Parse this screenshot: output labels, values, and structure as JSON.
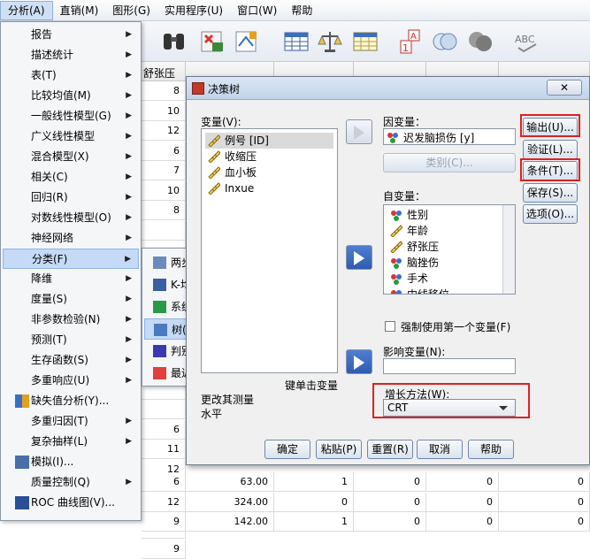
{
  "menubar": [
    {
      "label": "分析(A)"
    },
    {
      "label": "直销(M)"
    },
    {
      "label": "图形(G)"
    },
    {
      "label": "实用程序(U)"
    },
    {
      "label": "窗口(W)"
    },
    {
      "label": "帮助"
    }
  ],
  "analyze_menu": [
    {
      "label": "报告",
      "arrow": true
    },
    {
      "label": "描述统计",
      "arrow": true
    },
    {
      "label": "表(T)",
      "arrow": true
    },
    {
      "label": "比较均值(M)",
      "arrow": true
    },
    {
      "label": "一般线性模型(G)",
      "arrow": true
    },
    {
      "label": "广义线性模型",
      "arrow": true
    },
    {
      "label": "混合模型(X)",
      "arrow": true
    },
    {
      "label": "相关(C)",
      "arrow": true
    },
    {
      "label": "回归(R)",
      "arrow": true
    },
    {
      "label": "对数线性模型(O)",
      "arrow": true
    },
    {
      "label": "神经网络",
      "arrow": true
    },
    {
      "label": "分类(F)",
      "arrow": true
    },
    {
      "label": "降维",
      "arrow": true
    },
    {
      "label": "度量(S)",
      "arrow": true
    },
    {
      "label": "非参数检验(N)",
      "arrow": true
    },
    {
      "label": "预测(T)",
      "arrow": true
    },
    {
      "label": "生存函数(S)",
      "arrow": true
    },
    {
      "label": "多重响应(U)",
      "arrow": true
    },
    {
      "label": "缺失值分析(Y)...",
      "arrow": false
    },
    {
      "label": "多重归因(T)",
      "arrow": true
    },
    {
      "label": "复杂抽样(L)",
      "arrow": true
    },
    {
      "label": "模拟(I)...",
      "arrow": false
    },
    {
      "label": "质量控制(Q)",
      "arrow": true
    },
    {
      "label": "ROC 曲线图(V)...",
      "arrow": false
    }
  ],
  "classify_submenu": [
    {
      "label": "两步聚类(T)..."
    },
    {
      "label": "K-均值聚类(K)..."
    },
    {
      "label": "系统聚类(H)..."
    },
    {
      "label": "树(R)..."
    },
    {
      "label": "判别(D)..."
    },
    {
      "label": "最近邻元素(N)..."
    }
  ],
  "grid": {
    "visible_header": "舒张压",
    "left_col": [
      "8",
      "10",
      "12",
      "6",
      "7",
      "10",
      "8",
      "",
      "",
      "",
      "",
      "",
      "",
      "",
      "",
      "",
      "",
      "6",
      "11",
      "12",
      "7",
      "6",
      "12",
      "9"
    ],
    "rows": [
      [
        "6",
        "63.00",
        "1",
        "0",
        "0",
        "0"
      ],
      [
        "12",
        "324.00",
        "0",
        "0",
        "0",
        "0"
      ],
      [
        "9",
        "142.00",
        "1",
        "0",
        "0",
        "0"
      ]
    ]
  },
  "dialog": {
    "title": "决策树",
    "close": "✕",
    "variables_label": "变量(V):",
    "variables": [
      {
        "name": "例号 [ID]",
        "icon": "ruler-icon",
        "selected": true
      },
      {
        "name": "收缩压",
        "icon": "ruler-icon"
      },
      {
        "name": "血小板",
        "icon": "ruler-icon"
      },
      {
        "name": "Inxue",
        "icon": "ruler-icon"
      }
    ],
    "dependent_label": "因变量：",
    "dependent_value": "迟发脑损伤 [y]",
    "categories_button": "类别(C)...",
    "independent_label": "自变量：",
    "independents": [
      {
        "name": "性别",
        "icon": "nominal-icon"
      },
      {
        "name": "年龄",
        "icon": "ruler-icon"
      },
      {
        "name": "舒张压",
        "icon": "ruler-icon"
      },
      {
        "name": "脑挫伤",
        "icon": "nominal-icon"
      },
      {
        "name": "手术",
        "icon": "nominal-icon"
      },
      {
        "name": "中线移位",
        "icon": "nominal-icon"
      },
      {
        "name": "脑肿胀",
        "icon": "nominal-icon"
      }
    ],
    "force_first": "强制使用第一个变量(F)",
    "influence_label": "影响变量(N):",
    "growth_label": "增长方法(W):",
    "growth_value": "CRT",
    "left_note_1": "键单击变量",
    "left_note_2": "更改其测量",
    "left_note_3": "水平",
    "side_buttons": [
      "输出(U)...",
      "验证(L)...",
      "条件(T)...",
      "保存(S)...",
      "选项(O)..."
    ],
    "bottom_buttons": [
      "确定",
      "粘贴(P)",
      "重置(R)",
      "取消",
      "帮助"
    ],
    "header_strip": [
      "",
      "",
      "",
      "",
      ""
    ]
  },
  "colors": {
    "highlight": "#c4daf6",
    "red_box": "#e02020",
    "arrow_active": "#2f5cb0"
  }
}
